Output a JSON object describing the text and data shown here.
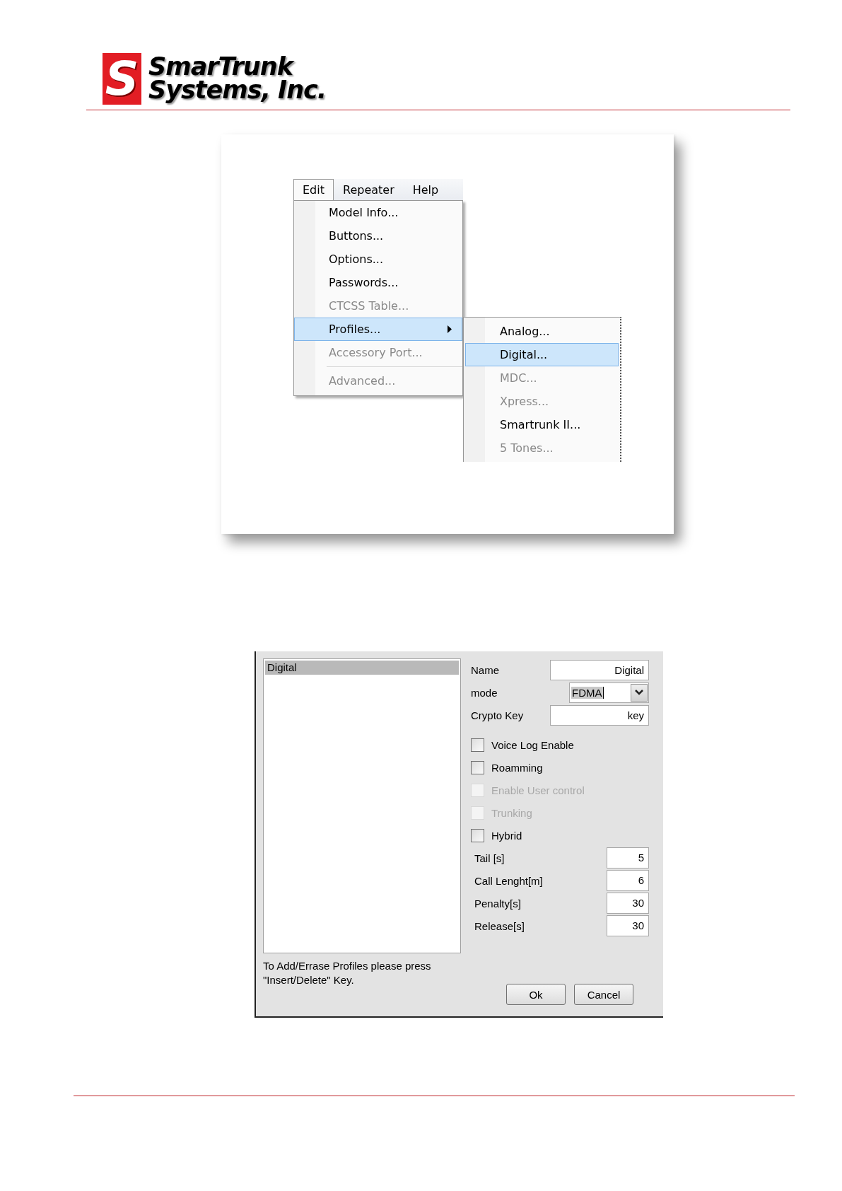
{
  "header": {
    "logo": {
      "mark": "S",
      "line_1": "SmarTrunk",
      "line_2": "Systems, Inc."
    }
  },
  "menu_screenshot": {
    "menubar": [
      {
        "label": "Edit",
        "selected": true
      },
      {
        "label": "Repeater",
        "selected": false
      },
      {
        "label": "Help",
        "selected": false
      }
    ],
    "dropdown": [
      {
        "kind": "item",
        "label": "Model Info...",
        "disabled": false,
        "selected": false,
        "has_submenu": false
      },
      {
        "kind": "item",
        "label": "Buttons...",
        "disabled": false,
        "selected": false,
        "has_submenu": false
      },
      {
        "kind": "item",
        "label": "Options...",
        "disabled": false,
        "selected": false,
        "has_submenu": false
      },
      {
        "kind": "item",
        "label": "Passwords...",
        "disabled": false,
        "selected": false,
        "has_submenu": false
      },
      {
        "kind": "item",
        "label": "CTCSS Table...",
        "disabled": true,
        "selected": false,
        "has_submenu": false
      },
      {
        "kind": "item",
        "label": "Profiles...",
        "disabled": false,
        "selected": true,
        "has_submenu": true
      },
      {
        "kind": "item",
        "label": "Accessory Port...",
        "disabled": true,
        "selected": false,
        "has_submenu": false
      },
      {
        "kind": "separator"
      },
      {
        "kind": "item",
        "label": "Advanced...",
        "disabled": true,
        "selected": false,
        "has_submenu": false
      }
    ],
    "submenu": [
      {
        "label": "Analog...",
        "disabled": false,
        "selected": false
      },
      {
        "label": "Digital...",
        "disabled": false,
        "selected": true
      },
      {
        "label": "MDC...",
        "disabled": true,
        "selected": false
      },
      {
        "label": "Xpress...",
        "disabled": true,
        "selected": false
      },
      {
        "label": "Smartrunk II...",
        "disabled": false,
        "selected": false
      },
      {
        "label": "5 Tones...",
        "disabled": true,
        "selected": false
      }
    ]
  },
  "dialog": {
    "profiles": [
      {
        "label": "Digital",
        "selected": true
      }
    ],
    "fields": [
      {
        "kind": "text",
        "label": "Name",
        "value": "Digital"
      },
      {
        "kind": "combo",
        "label": "mode",
        "value": "FDMA",
        "highlighted": true
      },
      {
        "kind": "text",
        "label": "Crypto Key",
        "value": "key"
      }
    ],
    "checkboxes": [
      {
        "label": "Voice Log Enable",
        "checked": false,
        "disabled": false
      },
      {
        "label": "Roamming",
        "checked": false,
        "disabled": false
      },
      {
        "label": "Enable User control",
        "checked": false,
        "disabled": true
      },
      {
        "label": "Trunking",
        "checked": false,
        "disabled": true
      },
      {
        "label": "Hybrid",
        "checked": false,
        "disabled": false
      }
    ],
    "numeric_fields": [
      {
        "label": "Tail [s]",
        "value": "5"
      },
      {
        "label": "Call Lenght[m]",
        "value": "6"
      },
      {
        "label": "Penalty[s]",
        "value": "30"
      },
      {
        "label": "Release[s]",
        "value": "30"
      }
    ],
    "hint": "To Add/Errase Profiles please press \"Insert/Delete\" Key.",
    "buttons": [
      "Ok",
      "Cancel"
    ]
  }
}
